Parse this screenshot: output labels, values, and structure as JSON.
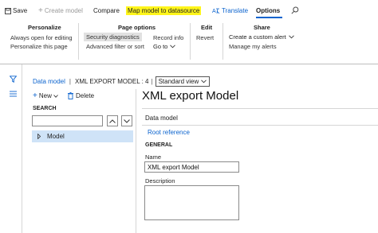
{
  "toolbar": {
    "save_label": "Save",
    "create_model_label": "Create model",
    "compare_label": "Compare",
    "map_label": "Map model to datasource",
    "translate_label": "Translate",
    "options_tab_label": "Options"
  },
  "ribbon": {
    "personalize": {
      "title": "Personalize",
      "items": [
        "Always open for editing",
        "Personalize this page"
      ]
    },
    "page_options": {
      "title": "Page options",
      "items": [
        "Security diagnostics",
        "Advanced filter or sort",
        "Record info",
        "Go to"
      ]
    },
    "edit": {
      "title": "Edit",
      "items": [
        "Revert"
      ]
    },
    "share": {
      "title": "Share",
      "items": [
        "Create a custom alert",
        "Manage my alerts"
      ]
    }
  },
  "breadcrumb": {
    "root": "Data model",
    "separator": "|",
    "current": "XML EXPORT MODEL : 4",
    "view": "Standard view"
  },
  "actions": {
    "new_label": "New",
    "delete_label": "Delete"
  },
  "search": {
    "label": "SEARCH",
    "value": ""
  },
  "tree": {
    "items": [
      "Model"
    ]
  },
  "detail": {
    "title": "XML export Model",
    "section_label": "Data model",
    "root_reference": "Root reference",
    "general_label": "GENERAL",
    "name_label": "Name",
    "name_value": "XML export Model",
    "description_label": "Description",
    "description_value": ""
  },
  "colors": {
    "accent": "#0b63ce",
    "highlight": "#fff51a",
    "selected": "#cfe3f7"
  }
}
